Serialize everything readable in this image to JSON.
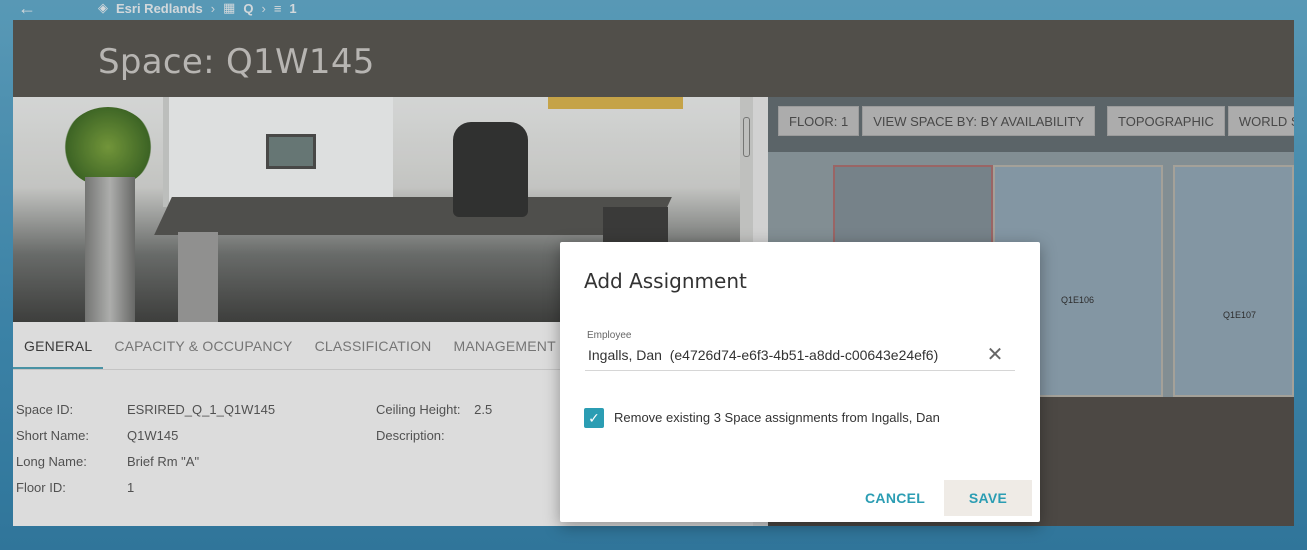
{
  "topbar": {
    "back_icon": "arrow-left-icon",
    "site": "Esri Redlands",
    "building": "Q",
    "level": "1"
  },
  "panel": {
    "title": "Space: Q1W145"
  },
  "tabs": [
    {
      "label": "GENERAL",
      "active": true
    },
    {
      "label": "CAPACITY & OCCUPANCY",
      "active": false
    },
    {
      "label": "CLASSIFICATION",
      "active": false
    },
    {
      "label": "MANAGEMENT",
      "active": false
    }
  ],
  "attributes": {
    "space_id": {
      "label": "Space ID:",
      "value": "ESRIRED_Q_1_Q1W145"
    },
    "short_name": {
      "label": "Short Name:",
      "value": "Q1W145"
    },
    "long_name": {
      "label": "Long Name:",
      "value": "Brief Rm \"A\""
    },
    "floor_id": {
      "label": "Floor ID:",
      "value": "1"
    },
    "ceiling_height": {
      "label": "Ceiling Height:",
      "value": "2.5"
    },
    "description": {
      "label": "Description:",
      "value": ""
    }
  },
  "map": {
    "floor_button": "FLOOR: 1",
    "view_button": "VIEW SPACE BY: BY AVAILABILITY",
    "topo_button": "TOPOGRAPHIC",
    "world_button": "WORLD STRE",
    "room_labels": [
      "Q1E106",
      "Q1E107"
    ]
  },
  "dialog": {
    "title": "Add Assignment",
    "employee_label": "Employee",
    "employee_value": "Ingalls, Dan  (e4726d74-e6f3-4b51-a8dd-c00643e24ef6)",
    "remove_checked": true,
    "remove_label": "Remove existing 3 Space assignments from Ingalls, Dan",
    "cancel": "CANCEL",
    "save": "SAVE"
  },
  "colors": {
    "accent": "#2b9db3",
    "header": "#55524d"
  }
}
